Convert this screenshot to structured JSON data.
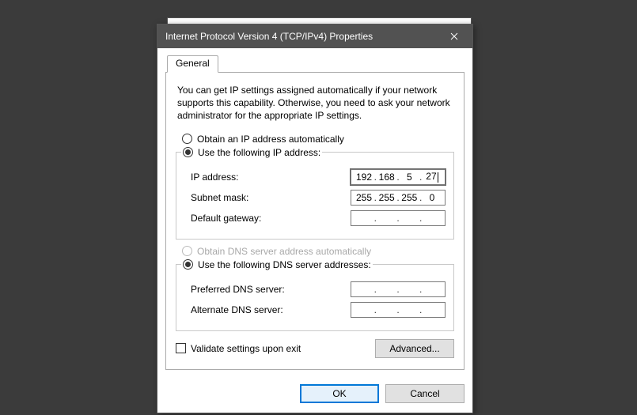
{
  "window": {
    "title": "Internet Protocol Version 4 (TCP/IPv4) Properties"
  },
  "tab": {
    "general": "General"
  },
  "intro": "You can get IP settings assigned automatically if your network supports this capability. Otherwise, you need to ask your network administrator for the appropriate IP settings.",
  "ip_section": {
    "auto_label": "Obtain an IP address automatically",
    "manual_label": "Use the following IP address:",
    "ip_label": "IP address:",
    "ip_value": [
      "192",
      "168",
      "5",
      "27"
    ],
    "subnet_label": "Subnet mask:",
    "subnet_value": [
      "255",
      "255",
      "255",
      "0"
    ],
    "gateway_label": "Default gateway:",
    "gateway_value": [
      "",
      "",
      "",
      ""
    ]
  },
  "dns_section": {
    "auto_label": "Obtain DNS server address automatically",
    "manual_label": "Use the following DNS server addresses:",
    "preferred_label": "Preferred DNS server:",
    "preferred_value": [
      "",
      "",
      "",
      ""
    ],
    "alternate_label": "Alternate DNS server:",
    "alternate_value": [
      "",
      "",
      "",
      ""
    ]
  },
  "validate_label": "Validate settings upon exit",
  "buttons": {
    "advanced": "Advanced...",
    "ok": "OK",
    "cancel": "Cancel"
  }
}
